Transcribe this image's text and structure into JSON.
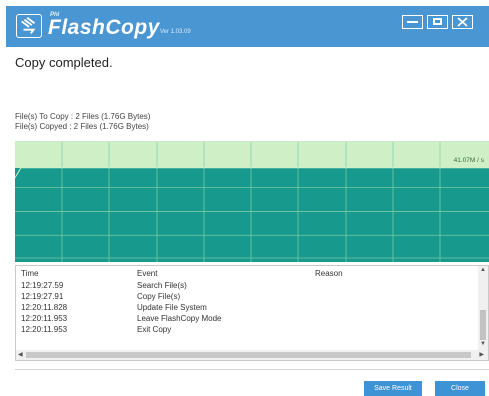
{
  "app": {
    "brand_small": "Phi",
    "name": "FlashCopy",
    "version": "Ver 1.03.09"
  },
  "status": "Copy completed.",
  "info": {
    "to_copy": "File(s) To Copy :  2 Files (1.76G Bytes)",
    "copied": "File(s) Copyed :  2 Files (1.76G Bytes)"
  },
  "chart": {
    "speed_label": "41.07M / s"
  },
  "log": {
    "headers": {
      "time": "Time",
      "event": "Event",
      "reason": "Reason"
    },
    "rows": [
      {
        "time": "12:19:27.59",
        "event": "Search File(s)",
        "reason": ""
      },
      {
        "time": "12:19:27.91",
        "event": "Copy File(s)",
        "reason": ""
      },
      {
        "time": "12:20:11.828",
        "event": "Update File System",
        "reason": ""
      },
      {
        "time": "12:20:11.953",
        "event": "Leave FlashCopy Mode",
        "reason": ""
      },
      {
        "time": "12:20:11.953",
        "event": "Exit Copy",
        "reason": ""
      }
    ]
  },
  "buttons": {
    "save": "Save Result",
    "close": "Close"
  },
  "colors": {
    "titlebar": "#4a96d2",
    "chart_fill": "#179a8d",
    "chart_top": "#cff0c6",
    "button": "#3e93d4"
  }
}
